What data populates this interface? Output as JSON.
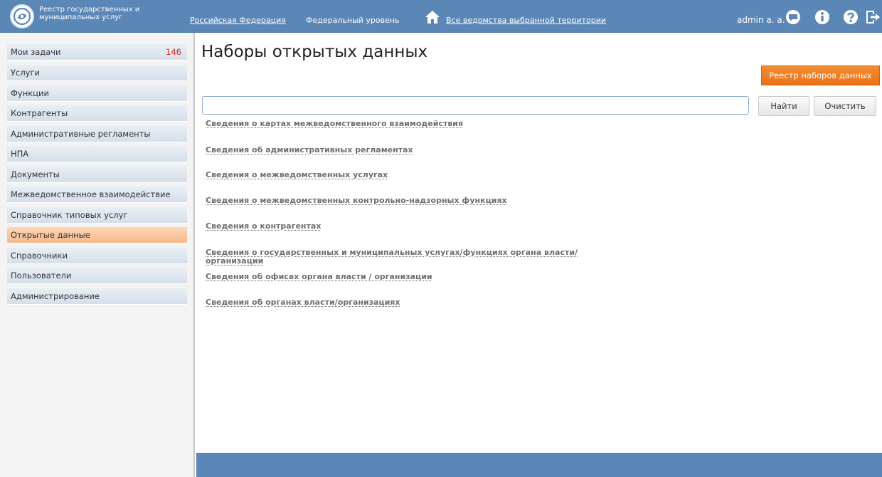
{
  "header": {
    "logo_text": "Реестр государственных и муниципальных услуг",
    "region_link": "Российская Федерация",
    "level_text": "Федеральный уровень",
    "departments_link": "Все ведомства выбранной территории",
    "user_name": "admin a. a.",
    "icons": [
      "chat-icon",
      "info-icon",
      "help-icon",
      "logout-icon"
    ],
    "brand_color": "#5b87b7"
  },
  "sidebar": {
    "items": [
      {
        "label": "Мои задачи",
        "count": "146"
      },
      {
        "label": "Услуги"
      },
      {
        "label": "Функции"
      },
      {
        "label": "Контрагенты"
      },
      {
        "label": "Административные регламенты"
      },
      {
        "label": "НПА"
      },
      {
        "label": "Документы"
      },
      {
        "label": "Межведомственное взаимодействие"
      },
      {
        "label": "Справочник типовых услуг"
      },
      {
        "label": "Открытые данные",
        "active": true
      },
      {
        "label": "Справочники"
      },
      {
        "label": "Пользователи"
      },
      {
        "label": "Администрирование"
      }
    ],
    "active_color": "#f6b98a",
    "count_color": "#d9251d"
  },
  "main": {
    "title": "Наборы открытых данных",
    "registry_button": "Реестр наборов данных",
    "search": {
      "value": "",
      "placeholder": ""
    },
    "find_button": "Найти",
    "clear_button": "Очистить",
    "datasets": [
      "Сведения о картах межведомственного взаимодействия",
      "Сведения об административных регламентах",
      "Сведения о межведомственных услугах",
      "Сведения о межведомственных контрольно-надзорных функциях",
      "Сведения о контрагентах",
      "Сведения о государственных и муниципальных услугах/функциях органа власти/ организации",
      "Сведения об офисах органа власти / организации",
      "Сведения об органах власти/организациях"
    ],
    "accent_color": "#e8711a"
  }
}
